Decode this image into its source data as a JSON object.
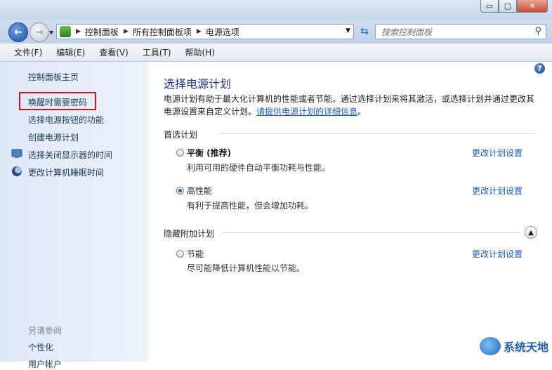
{
  "window": {
    "min": "▭",
    "max": "▢",
    "close": "✕"
  },
  "address": {
    "crumbs": [
      "控制面板",
      "所有控制面板项",
      "电源选项"
    ],
    "search_placeholder": "搜索控制面板"
  },
  "menu": [
    "文件(F)",
    "编辑(E)",
    "查看(V)",
    "工具(T)",
    "帮助(H)"
  ],
  "sidebar": {
    "home": "控制面板主页",
    "items": [
      "唤醒时需要密码",
      "选择电源按钮的功能",
      "创建电源计划",
      "选择关闭显示器的时间",
      "更改计算机睡眠时间"
    ],
    "see_also_heading": "另请参阅",
    "see_also_items": [
      "个性化",
      "用户帐户"
    ]
  },
  "main": {
    "title": "选择电源计划",
    "desc_line": "电源计划有助于最大化计算机的性能或者节能。通过选择计划来将其激活，或选择计划并通过更改其电源设置来自定义计划。",
    "desc_link": "请提供电源计划的详细信息",
    "desc_end": "。",
    "preferred_heading": "首选计划",
    "hidden_heading": "隐藏附加计划",
    "plans": [
      {
        "name": "平衡 (推荐)",
        "desc": "利用可用的硬件自动平衡功耗与性能。",
        "link": "更改计划设置",
        "selected": false
      },
      {
        "name": "高性能",
        "desc": "有利于提高性能，但会增加功耗。",
        "link": "更改计划设置",
        "selected": true
      },
      {
        "name": "节能",
        "desc": "尽可能降低计算机性能以节能。",
        "link": "更改计划设置",
        "selected": false
      }
    ]
  },
  "watermark": "系统天地"
}
